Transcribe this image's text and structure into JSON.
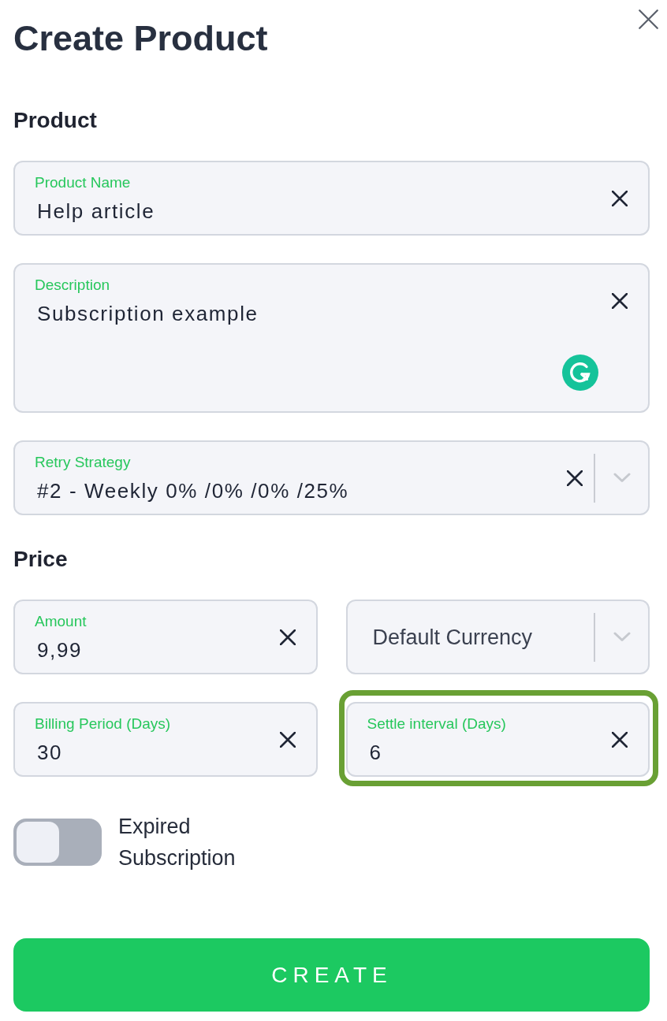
{
  "dialog": {
    "title": "Create Product"
  },
  "sections": [
    {
      "heading": "Product",
      "rows": [
        [
          {
            "kind": "text",
            "label": "Product Name",
            "value": "Help article"
          }
        ],
        [
          {
            "kind": "textarea",
            "label": "Description",
            "value": "Subscription example"
          }
        ],
        [
          {
            "kind": "select",
            "label": "Retry Strategy",
            "value": "#2 - Weekly 0% /0% /0% /25%"
          }
        ]
      ]
    },
    {
      "heading": "Price",
      "rows": [
        [
          {
            "kind": "text",
            "label": "Amount",
            "value": "9,99"
          },
          {
            "kind": "select",
            "placeholder": "Default Currency"
          }
        ],
        [
          {
            "kind": "text",
            "label": "Billing Period (Days)",
            "value": "30"
          },
          {
            "kind": "text",
            "label": "Settle interval (Days)",
            "value": "6",
            "highlighted": true
          }
        ]
      ]
    }
  ],
  "toggle": {
    "label": "Expired Subscription",
    "on": false
  },
  "submit": {
    "label": "CREATE"
  }
}
